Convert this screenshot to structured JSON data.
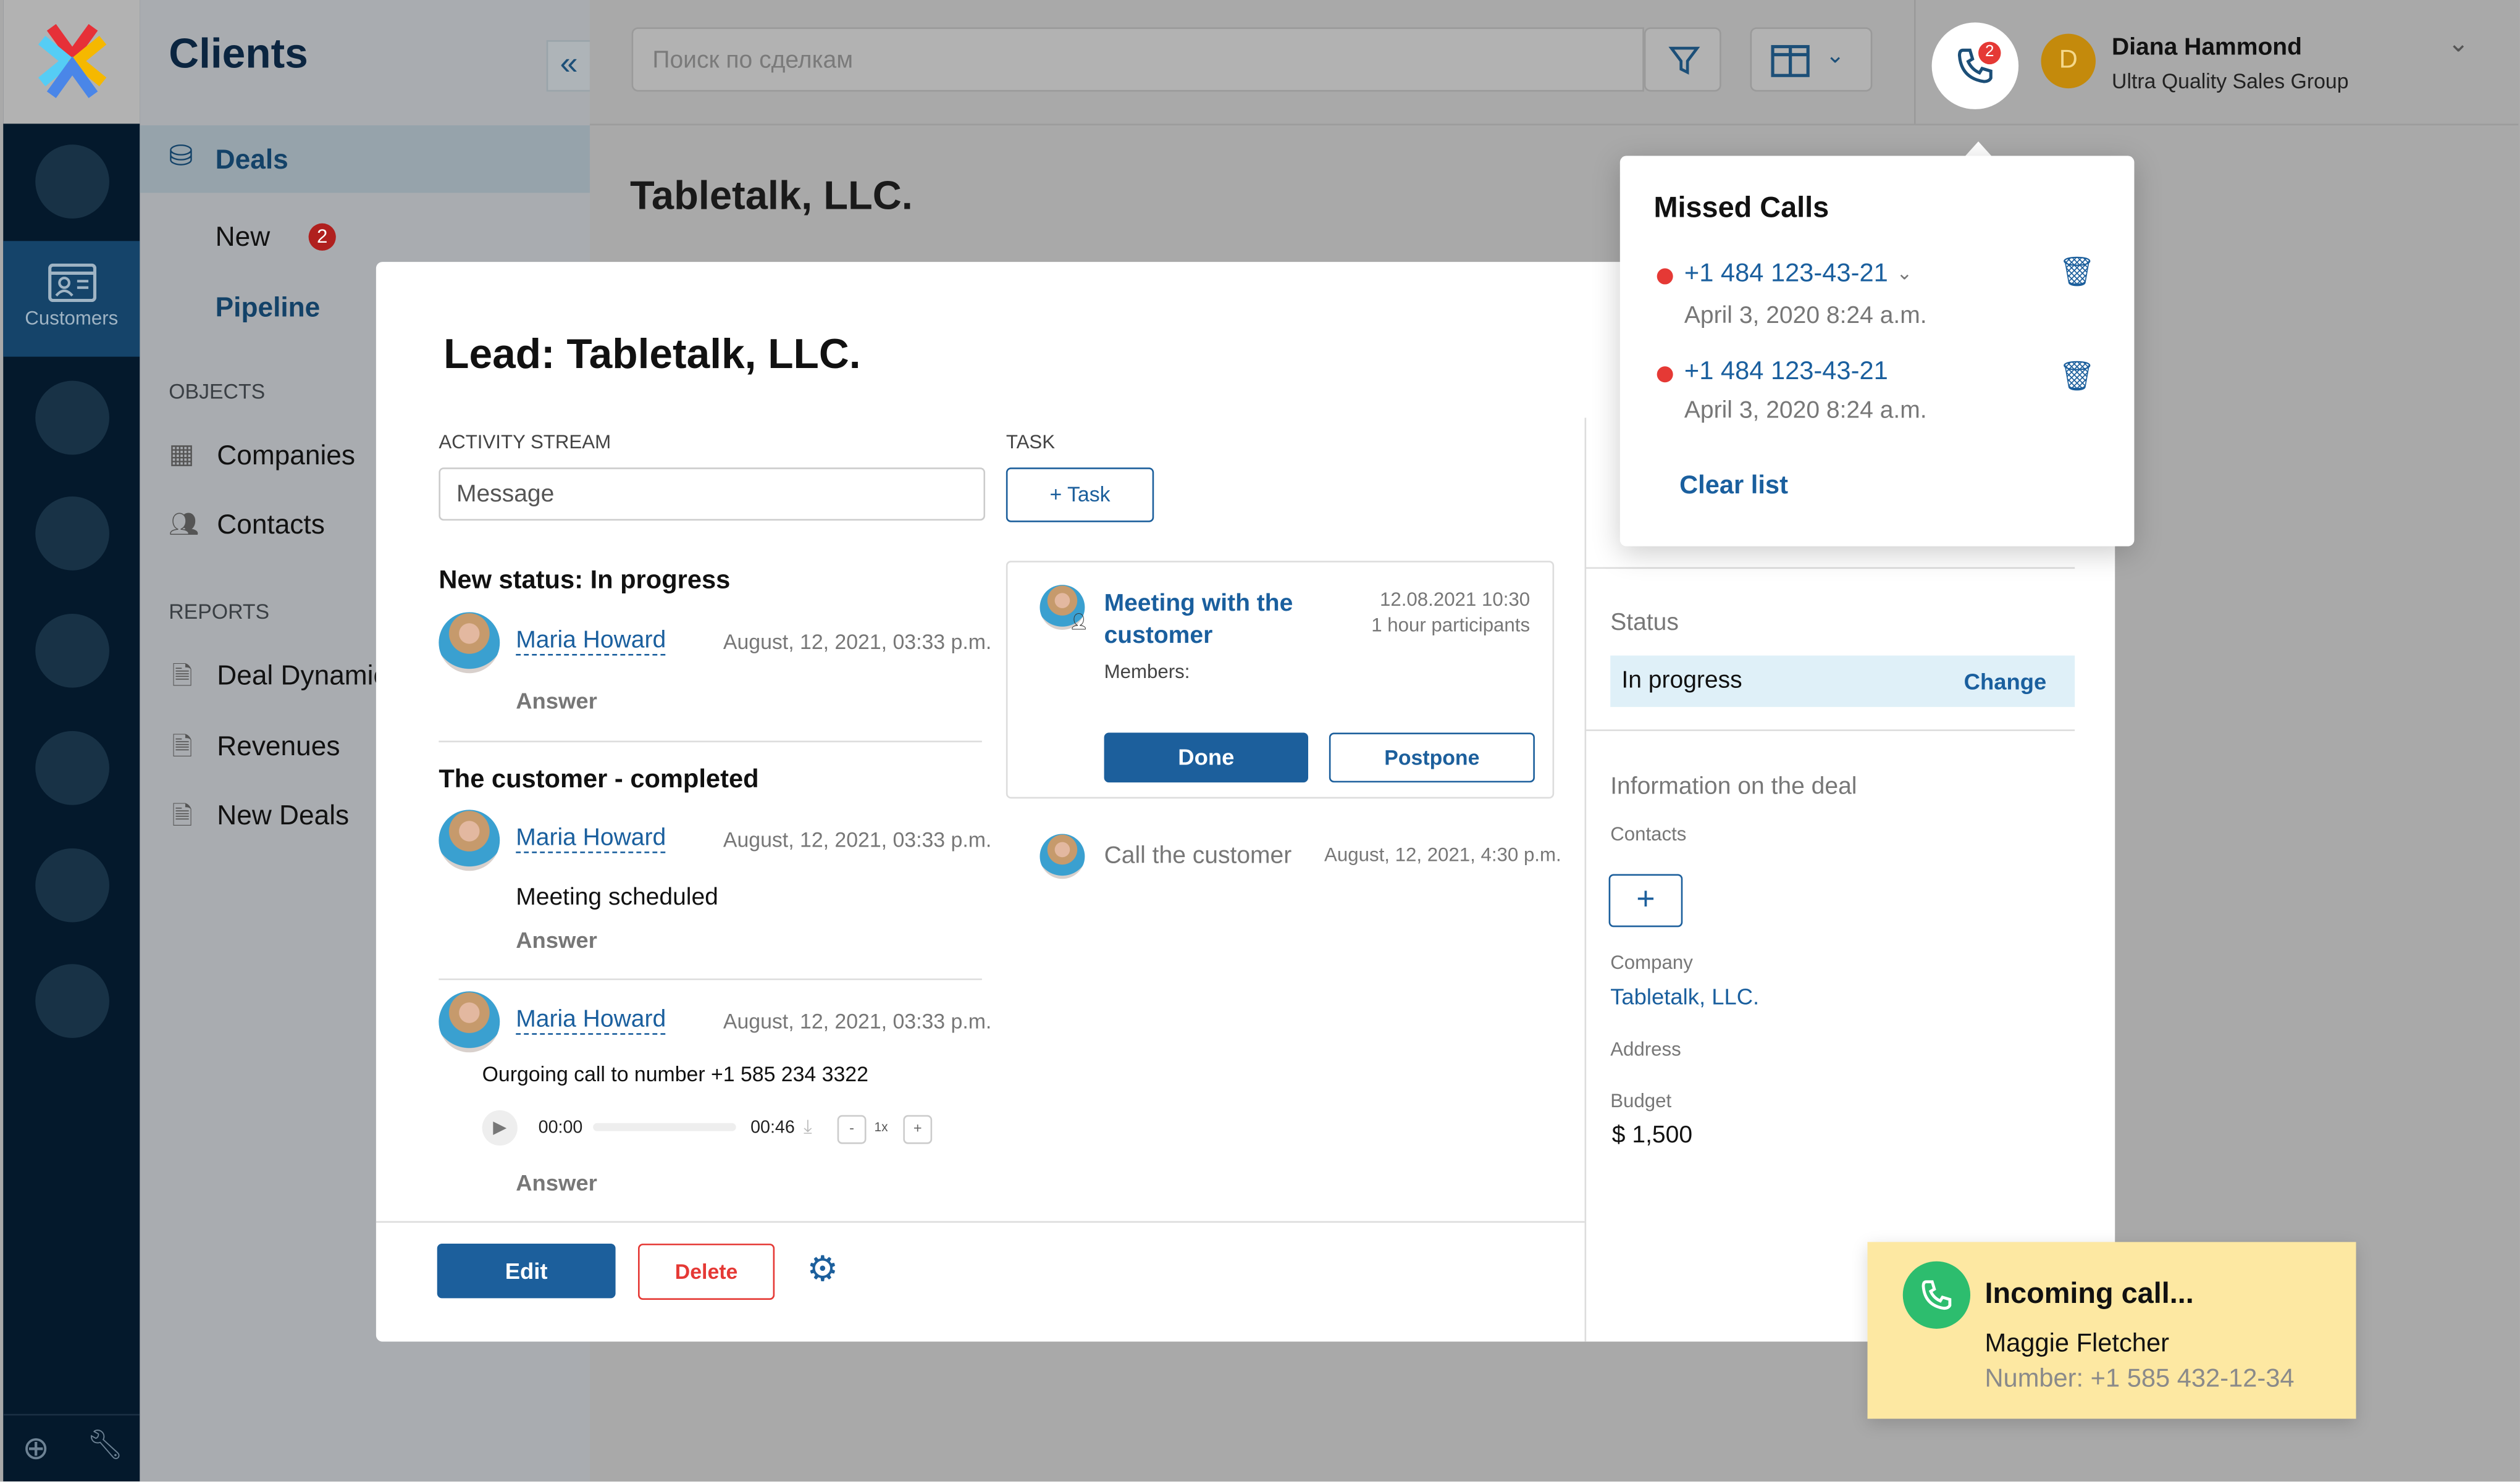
{
  "rail": {
    "customers_label": "Customers"
  },
  "sidebar": {
    "title": "Clients",
    "deals": "Deals",
    "new": "New",
    "new_badge": "2",
    "pipeline": "Pipeline",
    "objects_header": "OBJECTS",
    "companies": "Companies",
    "contacts": "Contacts",
    "reports_header": "REPORTS",
    "reports": [
      "Deal Dynamics",
      "Revenues",
      "New Deals"
    ]
  },
  "topbar": {
    "search_placeholder": "Поиск по сделкам",
    "calls_badge": "2",
    "user_initial": "D",
    "user_name": "Diana Hammond",
    "user_org": "Ultra Quality Sales Group"
  },
  "page": {
    "title": "Tabletalk, LLC."
  },
  "modal": {
    "title": "Lead: Tabletalk, LLC.",
    "activity_label": "ACTIVITY STREAM",
    "message_placeholder": "Message",
    "task_label": "TASK",
    "add_task": "+ Task",
    "stream": [
      {
        "heading": "New status: In progress",
        "author": "Maria Howard",
        "date": "August, 12, 2021, 03:33 p.m.",
        "answer": "Answer"
      },
      {
        "heading": "The customer - completed",
        "author": "Maria Howard",
        "date": "August, 12, 2021, 03:33 p.m.",
        "body": "Meeting scheduled",
        "answer": "Answer"
      },
      {
        "author": "Maria Howard",
        "date": "August, 12, 2021, 03:33 p.m.",
        "body": "Ourgoing call to number +1 585 234 3322",
        "player": {
          "current": "00:00",
          "total": "00:46",
          "speed": "1x",
          "progress": 0
        },
        "answer": "Answer"
      }
    ],
    "task_card": {
      "title": "Meeting with the customer",
      "date": "12.08.2021 10:30",
      "duration": "1 hour participants",
      "members": "Members:",
      "done": "Done",
      "postpone": "Postpone"
    },
    "task2": {
      "title": "Call the customer",
      "date": "August, 12, 2021, 4:30 p.m."
    },
    "right": {
      "status_label": "Status",
      "status": "In progress",
      "change": "Change",
      "info_header": "Information on the deal",
      "contacts_label": "Contacts",
      "add": "+",
      "company_label": "Company",
      "company": "Tabletalk, LLC.",
      "address_label": "Address",
      "budget_label": "Budget",
      "budget": "$ 1,500"
    },
    "footer": {
      "edit": "Edit",
      "delete": "Delete"
    }
  },
  "missed_calls": {
    "title": "Missed Calls",
    "items": [
      {
        "number": "+1 484 123-43-21",
        "date": "April 3, 2020 8:24 a.m."
      },
      {
        "number": "+1 484 123-43-21",
        "date": "April 3, 2020 8:24 a.m."
      }
    ],
    "clear": "Clear list"
  },
  "incoming": {
    "title": "Incoming call...",
    "name": "Maggie Fletcher",
    "number": "Number: +1 585 432-12-34"
  },
  "colors": {
    "accent": "#1c5f9c",
    "missed": "#e53935",
    "incoming_bg": "#fde8a2",
    "call_green": "#2dbd6e"
  }
}
